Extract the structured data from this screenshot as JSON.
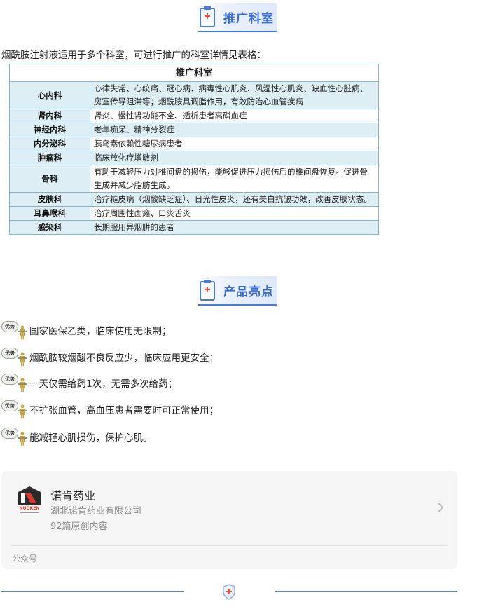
{
  "section1": {
    "title": "推广科室"
  },
  "intro": "烟酰胺注射液适用于多个科室，可进行推广的科室详情见表格：",
  "table": {
    "header": "推广科室",
    "rows": [
      {
        "dept": "心内科",
        "desc": "心律失常、心绞痛、冠心病、病毒性心肌炎、风湿性心肌炎、缺血性心脏病、房室传导阻滞等；烟酰胺具调脂作用，有效防治心血管疾病"
      },
      {
        "dept": "肾内科",
        "desc": "肾炎、慢性肾功能不全、透析患者高磷血症"
      },
      {
        "dept": "神经内科",
        "desc": "老年痴呆、精神分裂症"
      },
      {
        "dept": "内分泌科",
        "desc": "胰岛素依赖性糖尿病患者"
      },
      {
        "dept": "肿瘤科",
        "desc": "临床放化疗增敏剂"
      },
      {
        "dept": "骨科",
        "desc": "有助于减轻压力对椎间盘的损伤，能够促进压力损伤后的椎间盘恢复。促进骨生成并减少脂肪生成。"
      },
      {
        "dept": "皮肤科",
        "desc": "治疗糙皮病（烟酸缺乏症）、日光性皮炎，还有美白抗皱功效，改善皮肤状态。"
      },
      {
        "dept": "耳鼻喉科",
        "desc": "治疗周围性面瘫、口炎舌炎"
      },
      {
        "dept": "感染科",
        "desc": "长期服用异烟肼的患者"
      }
    ]
  },
  "section2": {
    "title": "产品亮点"
  },
  "highlights": {
    "badge": "优势",
    "items": [
      "国家医保乙类，临床使用无限制；",
      "烟酰胺较烟酸不良反应少，临床应用更安全；",
      "一天仅需给药1次，无需多次给药；",
      "不扩张血管，高血压患者需要时可正常使用；",
      "能减轻心肌损伤，保护心肌。"
    ]
  },
  "account": {
    "name": "诺肯药业",
    "company": "湖北诺肯药业有限公司",
    "posts": "92篇原创内容",
    "type": "公众号",
    "logo_text": "NUOKEN"
  },
  "colors": {
    "accent": "#3a6bd0",
    "table_border": "#8ab4c8",
    "table_fill": "#ddeef4"
  }
}
